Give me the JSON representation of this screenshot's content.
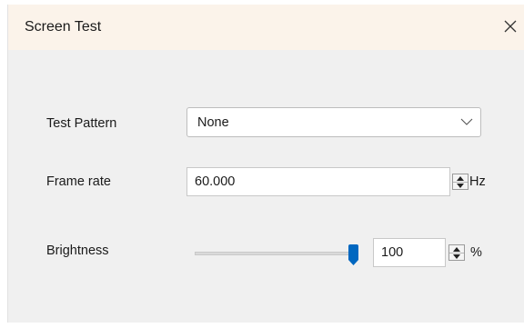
{
  "window": {
    "title": "Screen Test",
    "close_glyph": "✕"
  },
  "test_pattern": {
    "label": "Test Pattern",
    "selected": "None",
    "chevron_icon": "chevron-down-icon"
  },
  "frame_rate": {
    "label": "Frame rate",
    "value": "60.000",
    "unit": "Hz"
  },
  "brightness": {
    "label": "Brightness",
    "value": "100",
    "unit": "%",
    "level_percent": 100
  },
  "colors": {
    "titlebar_bg": "#fbf3ea",
    "window_bg": "#f0f0f0",
    "slider_thumb": "#0067c0"
  }
}
